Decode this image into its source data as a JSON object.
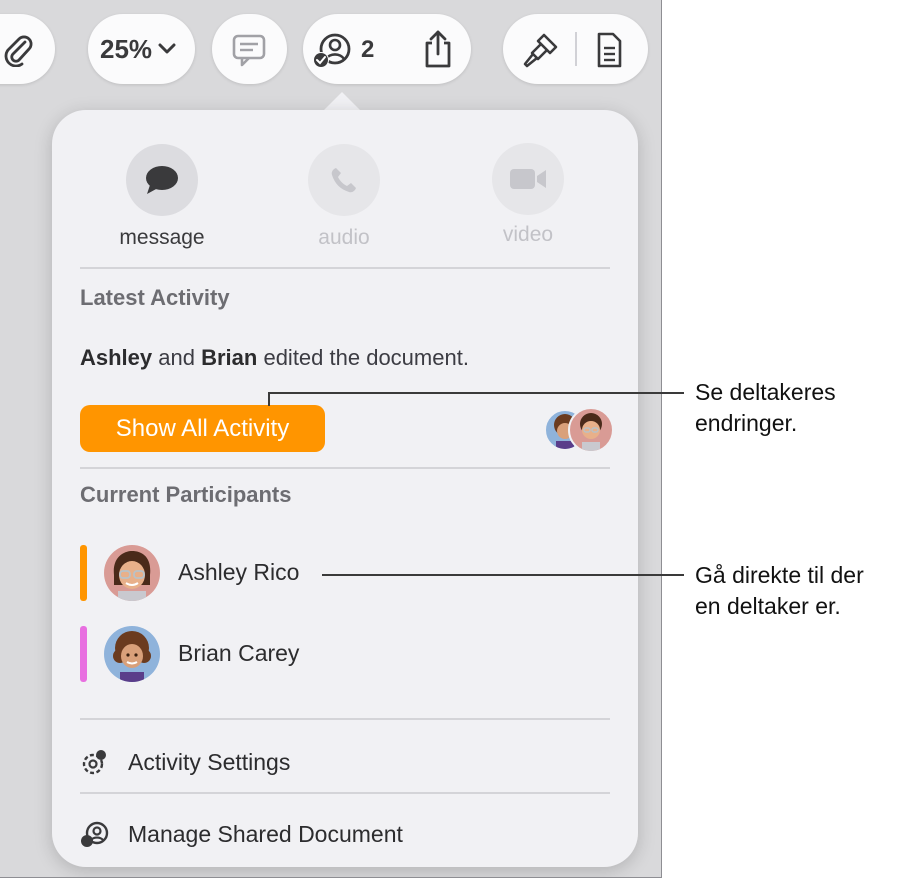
{
  "toolbar": {
    "zoom_label": "25%",
    "collab_count": "2",
    "icons": [
      "paperclip-icon",
      "chevron-down-icon",
      "comment-icon",
      "collaborate-icon",
      "share-icon",
      "paintbrush-icon",
      "document-icon"
    ]
  },
  "popover": {
    "comm": [
      {
        "label": "message",
        "icon": "message-icon",
        "enabled": true
      },
      {
        "label": "audio",
        "icon": "phone-icon",
        "enabled": false
      },
      {
        "label": "video",
        "icon": "video-icon",
        "enabled": false
      }
    ],
    "latest_activity": {
      "heading": "Latest Activity",
      "name1": "Ashley",
      "and": " and ",
      "name2": "Brian",
      "rest": " edited the document.",
      "button": "Show All Activity"
    },
    "participants": {
      "heading": "Current Participants",
      "items": [
        {
          "name": "Ashley Rico",
          "color": "#ff9500"
        },
        {
          "name": "Brian Carey",
          "color": "#e86fe0"
        }
      ]
    },
    "menu": [
      {
        "label": "Activity Settings",
        "icon": "activity-settings-icon"
      },
      {
        "label": "Manage Shared Document",
        "icon": "manage-shared-icon"
      }
    ]
  },
  "callouts": {
    "first": [
      "Se deltakeres",
      "endringer."
    ],
    "second": [
      "Gå direkte til der",
      "en deltaker er."
    ]
  },
  "colors": {
    "accent": "#ff9500",
    "ashley": "#ff9500",
    "brian": "#e86fe0"
  }
}
